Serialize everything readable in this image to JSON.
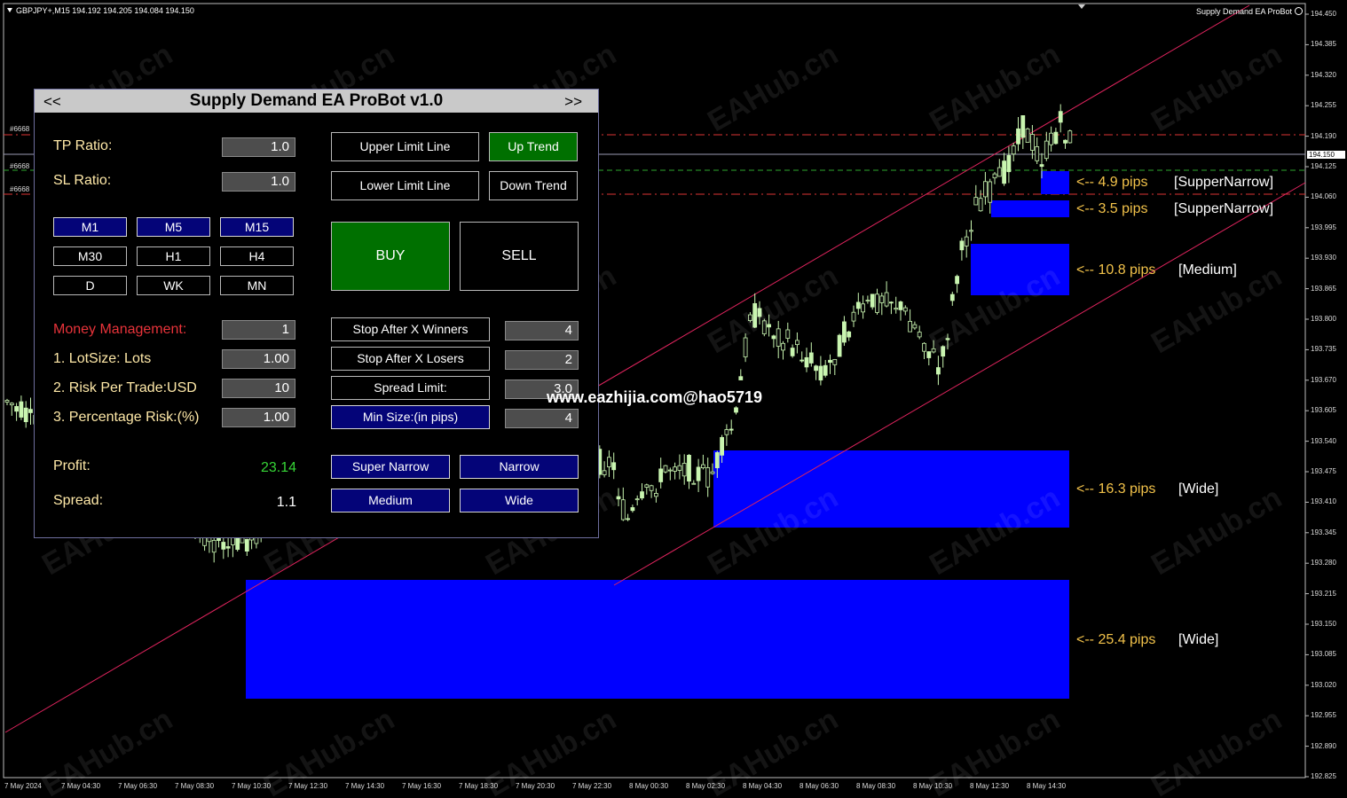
{
  "chart": {
    "symbol_header": "GBPJPY+,M15  194.192 194.205 194.084 194.150",
    "ea_name": "Supply Demand EA ProBot",
    "current_price_tag": "194.150",
    "hline_labels": [
      "#6668",
      "#6668",
      "#6668"
    ],
    "y_axis_labels": [
      "194.450",
      "194.385",
      "194.320",
      "194.255",
      "194.190",
      "194.125",
      "194.060",
      "193.995",
      "193.930",
      "193.865",
      "193.800",
      "193.735",
      "193.670",
      "193.605",
      "193.540",
      "193.475",
      "193.410",
      "193.345",
      "193.280",
      "193.215",
      "193.150",
      "193.085",
      "193.020",
      "192.955",
      "192.890",
      "192.825"
    ],
    "x_axis_labels": [
      "7 May 2024",
      "7 May 04:30",
      "7 May 06:30",
      "7 May 08:30",
      "7 May 10:30",
      "7 May 12:30",
      "7 May 14:30",
      "7 May 16:30",
      "7 May 18:30",
      "7 May 20:30",
      "7 May 22:30",
      "8 May 00:30",
      "8 May 02:30",
      "8 May 04:30",
      "8 May 06:30",
      "8 May 08:30",
      "8 May 10:30",
      "8 May 12:30",
      "8 May 14:30"
    ],
    "colors": {
      "bull": "#c9f5b0",
      "bear": "#0a0a0a",
      "zone": "#0000ff",
      "channel": "#e0245e",
      "level": "#d33",
      "tp_line": "#2ea82e",
      "zone_label": "#f2c24a"
    },
    "zones": [
      {
        "label": "<-- 4.9 pips",
        "type": "[SupperNarrow]"
      },
      {
        "label": "<-- 3.5 pips",
        "type": "[SupperNarrow]"
      },
      {
        "label": "<-- 10.8 pips",
        "type": "[Medium]"
      },
      {
        "label": "<-- 16.3 pips",
        "type": "[Wide]"
      },
      {
        "label": "<-- 25.4 pips",
        "type": "[Wide]"
      }
    ],
    "watermark": "EAHub.cn",
    "url_watermark": "www.eazhijia.com@hao5719"
  },
  "panel": {
    "title": "Supply Demand EA ProBot v1.0",
    "nav_prev": "<<",
    "nav_next": ">>",
    "tp_ratio_label": "TP Ratio:",
    "tp_ratio_value": "1.0",
    "sl_ratio_label": "SL Ratio:",
    "sl_ratio_value": "1.0",
    "upper_limit_button": "Upper Limit Line",
    "lower_limit_button": "Lower Limit Line",
    "up_trend_button": "Up Trend",
    "down_trend_button": "Down Trend",
    "timeframes": [
      "M1",
      "M5",
      "M15",
      "M30",
      "H1",
      "H4",
      "D",
      "WK",
      "MN"
    ],
    "buy_button": "BUY",
    "sell_button": "SELL",
    "money_management_label": "Money Management:",
    "money_management_value": "1",
    "lotsize_label": "1. LotSize: Lots",
    "lotsize_value": "1.00",
    "risk_trade_label": "2. Risk Per Trade:USD",
    "risk_trade_value": "10",
    "pct_risk_label": "3. Percentage Risk:(%)",
    "pct_risk_value": "1.00",
    "stop_winners_button": "Stop After X Winners",
    "stop_winners_value": "4",
    "stop_losers_button": "Stop After X Losers",
    "stop_losers_value": "2",
    "spread_limit_button": "Spread Limit:",
    "spread_limit_value": "3.0",
    "min_size_button": "Min Size:(in pips)",
    "min_size_value": "4",
    "profit_label": "Profit:",
    "profit_value": "23.14",
    "spread_label": "Spread:",
    "spread_value": "1.1",
    "size_buttons": [
      "Super Narrow",
      "Narrow",
      "Medium",
      "Wide"
    ],
    "profit_color": "#36d436"
  }
}
